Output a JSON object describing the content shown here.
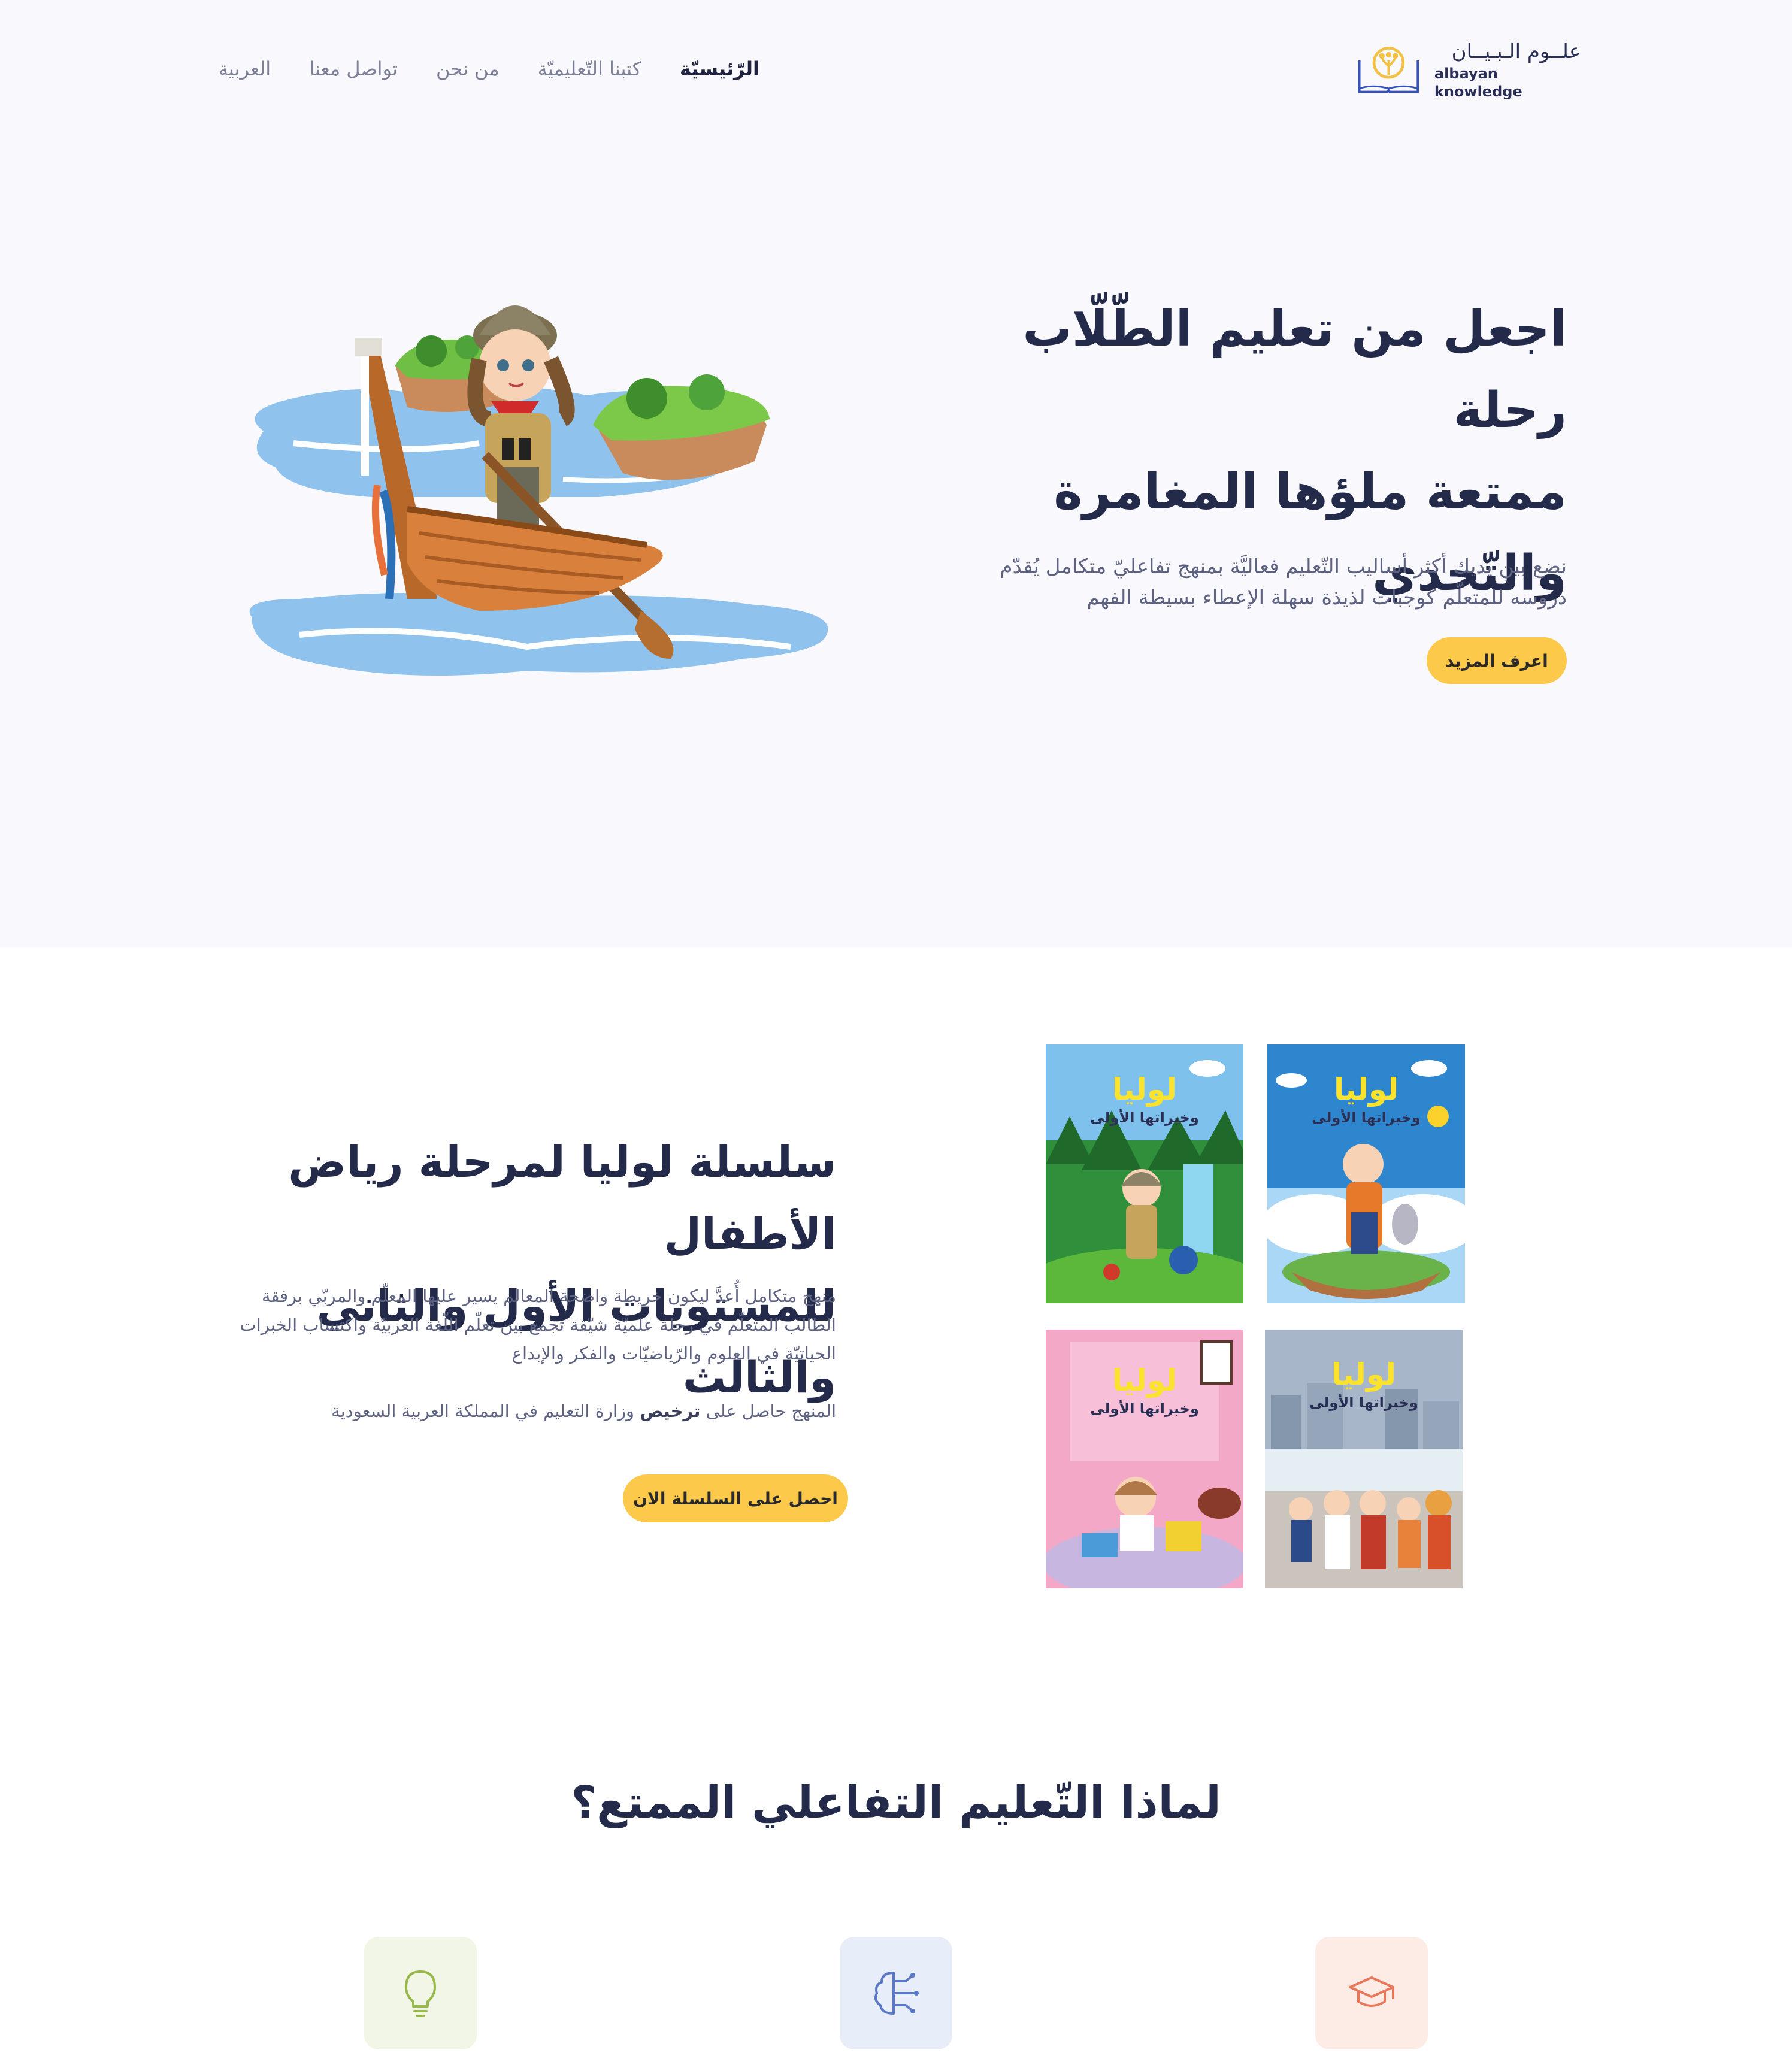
{
  "header": {
    "logo_ar": "علــوم الـبـيــان",
    "logo_en": "albayan knowledge",
    "nav": [
      {
        "label": "الرّئيسيّة",
        "active": true
      },
      {
        "label": "كتبنا التّعليميّة",
        "active": false
      },
      {
        "label": "من نحن",
        "active": false
      },
      {
        "label": "تواصل معنا",
        "active": false
      },
      {
        "label": "العربية",
        "active": false
      }
    ]
  },
  "hero": {
    "title_line1": "اجعل من تعليم الطّلّاب رحلة",
    "title_line2": "ممتعة ملؤها المغامرة",
    "title_line3": "والتّحدي",
    "desc_line1": "نضع بين يديك أكثر أساليب التّعليم فعاليَّة بمنهج تفاعليّ متكامل يُقدّم",
    "desc_line2": "دروسه للمتعلّم كوجبات لذيذة سهلة الإعطاء بسيطة الفهم",
    "button": "اعرف المزيد"
  },
  "series": {
    "title_line1": "سلسلة لوليا لمرحلة رياض الأطفال",
    "title_line2": "للمستويات الأول والثاني والثالث",
    "desc_line1": "منهج متكامل أُعدَّ ليكون خريطة واضحة المعالم يسير عليها المعلّم والمربّي برفقة",
    "desc_line2": "الطالب المتعلّم في رحلة علميّة شيّقة تجمع بين تعلّم اللّغة العربيّة واكتساب الخبرات",
    "desc_line3": "الحياتيّة في العلوم والرّياضيّات والفكر والإبداع",
    "license_pre": "المنهج حاصل على",
    "license_bold": "ترخيص",
    "license_post": "وزارة التعليم في المملكة العربية السعودية",
    "button": "احصل على السلسلة الان",
    "cover_title": "لوليا",
    "cover_subtitle": "وخبراتها الأولى"
  },
  "why": {
    "title": "لماذا التّعليم التفاعلي الممتع؟",
    "features": [
      {
        "icon": "graduation-cap-icon",
        "bg": "#fdebe6",
        "color": "#e8785c"
      },
      {
        "icon": "brain-circuit-icon",
        "bg": "#e8eef9",
        "color": "#5b78c8"
      },
      {
        "icon": "lightbulb-icon",
        "bg": "#f1f6e6",
        "color": "#98b84a"
      }
    ]
  },
  "colors": {
    "accent": "#fcc94b",
    "text_dark": "#232a4a",
    "text_muted": "#5d6280",
    "hero_bg": "#f9f9fd"
  }
}
